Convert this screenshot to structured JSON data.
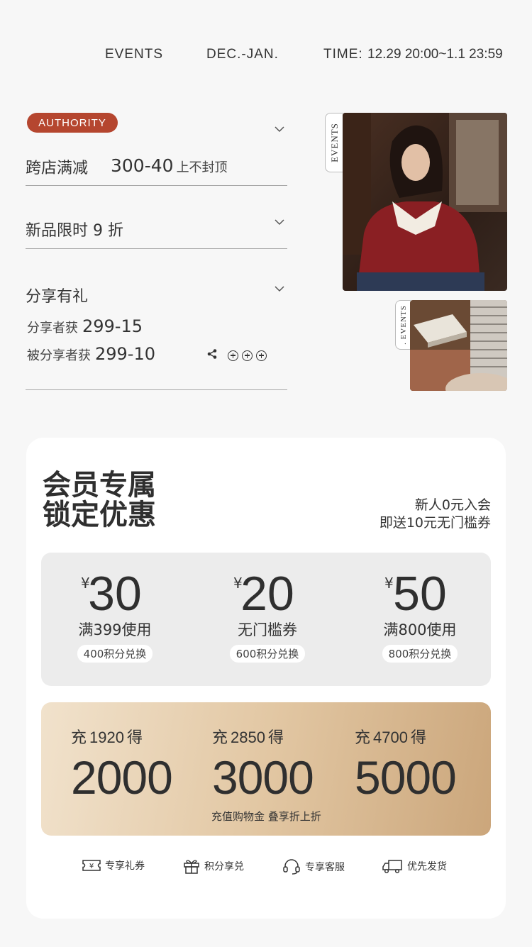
{
  "header": {
    "events_label": "EVENTS",
    "period": "DEC.-JAN.",
    "time_label": "TIME:",
    "time_value": "12.29 20:00~1.1 23:59"
  },
  "promo": {
    "badge": "AUTHORITY",
    "row1": {
      "title": "跨店满减",
      "value": "300-40",
      "note": "上不封顶"
    },
    "row2": {
      "title": "新品限时 9 折"
    },
    "row3": {
      "title": "分享有礼",
      "sharer_label": "分享者获",
      "sharer_value": "299-15",
      "shared_label": "被分享者获",
      "shared_value": "299-10"
    }
  },
  "photos": {
    "tab_label": "EVENTS",
    "tab_label_small": ". EVENTS"
  },
  "member": {
    "title_line1": "会员专属",
    "title_line2": "锁定优惠",
    "sub_line1": "新人0元入会",
    "sub_line2": "即送10元无门槛券",
    "coupons": [
      {
        "currency": "¥",
        "amount": "30",
        "condition": "满399使用",
        "points": "400积分兑换"
      },
      {
        "currency": "¥",
        "amount": "20",
        "condition": "无门槛券",
        "points": "600积分兑换"
      },
      {
        "currency": "¥",
        "amount": "50",
        "condition": "满800使用",
        "points": "800积分兑换"
      }
    ],
    "recharge": [
      {
        "prefix": "充",
        "pay": "1920",
        "suffix": "得",
        "get": "2000"
      },
      {
        "prefix": "充",
        "pay": "2850",
        "suffix": "得",
        "get": "3000"
      },
      {
        "prefix": "充",
        "pay": "4700",
        "suffix": "得",
        "get": "5000"
      }
    ],
    "recharge_note": "充值购物金  叠享折上折",
    "perks": [
      {
        "icon": "ticket-icon",
        "label": "专享礼券"
      },
      {
        "icon": "gift-icon",
        "label": "积分享兑"
      },
      {
        "icon": "headset-icon",
        "label": "专享客服"
      },
      {
        "icon": "truck-icon",
        "label": "优先发货"
      }
    ]
  },
  "colors": {
    "badge": "#b5462f",
    "page_bg": "#f7f7f7",
    "coupon_bg": "#ececec",
    "recharge_gradient_start": "#f1e2cc",
    "recharge_gradient_end": "#cba67b"
  }
}
